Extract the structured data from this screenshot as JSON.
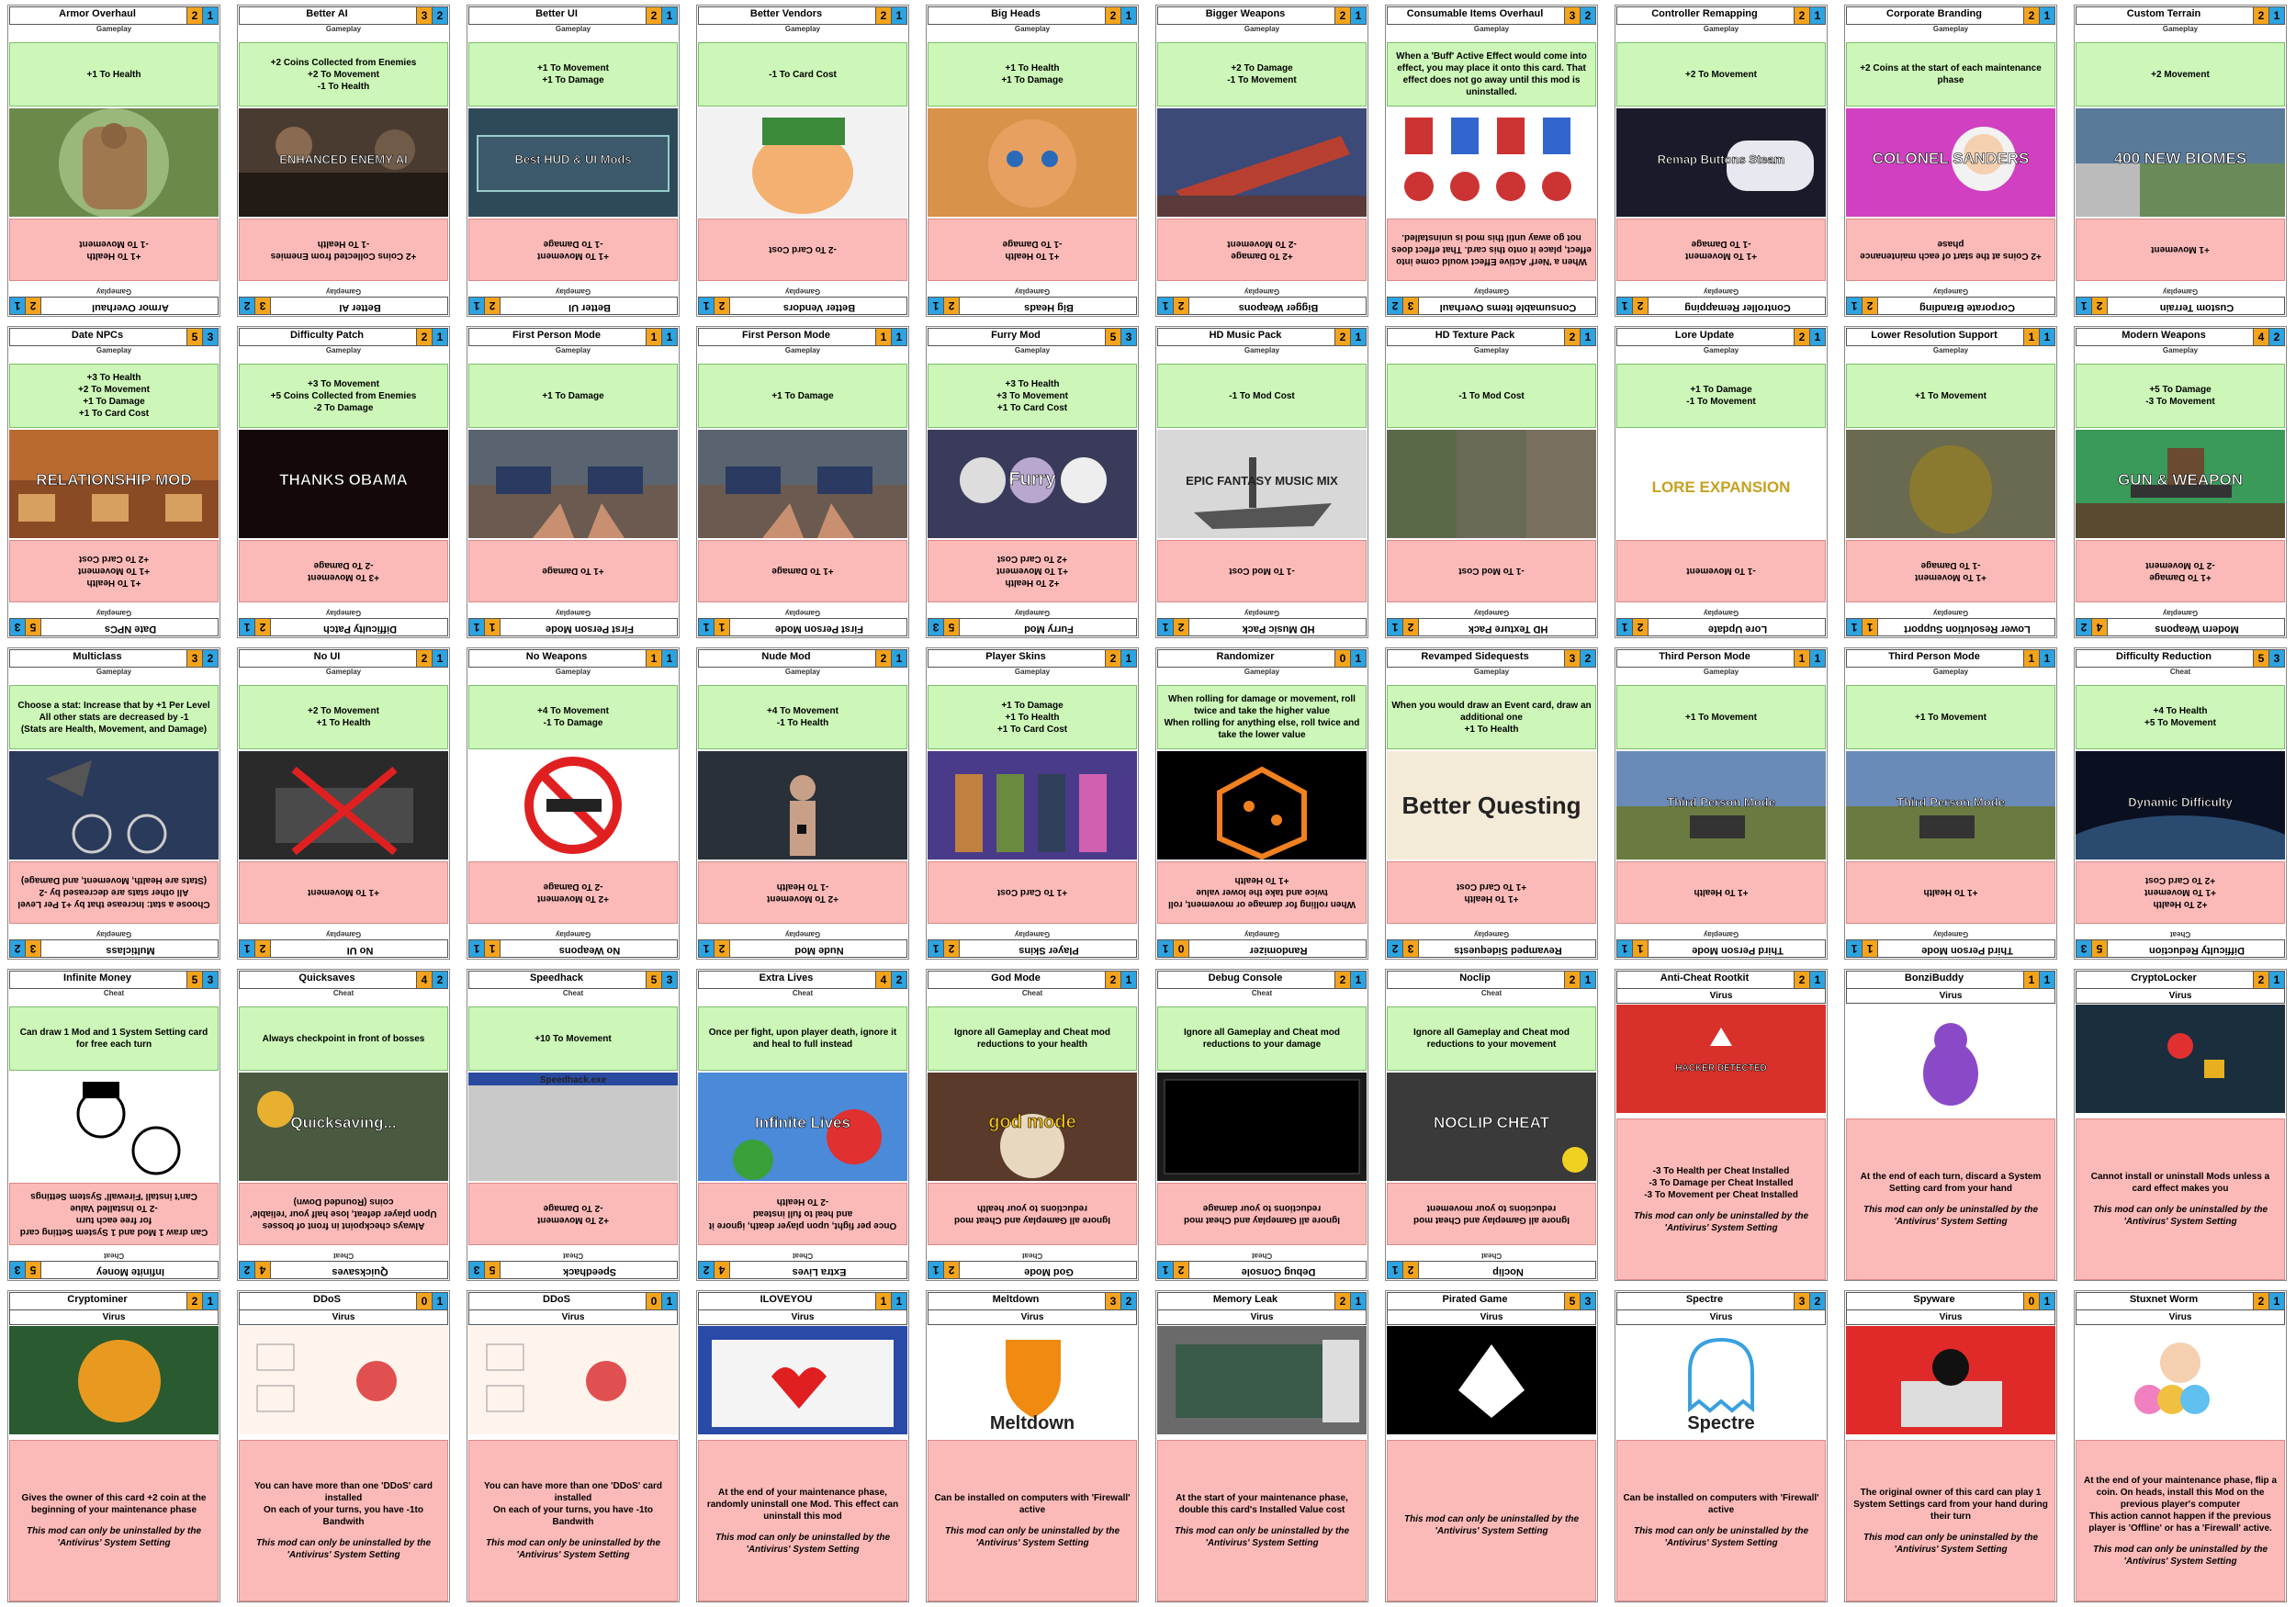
{
  "colors": {
    "buff": "#ccf7b8",
    "nerf": "#fbbab8",
    "cost": "#f4a41c",
    "slots": "#2da3e0"
  },
  "cards": [
    {
      "title": "Armor Overhaul",
      "cost": "2",
      "slots": "1",
      "tag": "Gameplay",
      "buff": "+1 To Health",
      "nerf": "+1 To Health\n-1 To Movement",
      "art": "armor-image"
    },
    {
      "title": "Better AI",
      "cost": "3",
      "slots": "2",
      "tag": "Gameplay",
      "buff": "+2 Coins Collected from Enemies\n+2 To Movement\n-1 To Health",
      "nerf": "+2 Coins Collected from Enemies\n-1 To Health",
      "art": "enemy-ai-image",
      "art_text": "ENHANCED ENEMY AI"
    },
    {
      "title": "Better UI",
      "cost": "2",
      "slots": "1",
      "tag": "Gameplay",
      "buff": "+1 To Movement\n+1 To Damage",
      "nerf": "+1 To Movement\n-1 To Damage",
      "art": "hud-image",
      "art_text": "Best HUD & UI Mods"
    },
    {
      "title": "Better Vendors",
      "cost": "2",
      "slots": "1",
      "tag": "Gameplay",
      "buff": "-1 To Card Cost",
      "nerf": "-2 To Card Cost",
      "art": "vendor-image"
    },
    {
      "title": "Big Heads",
      "cost": "2",
      "slots": "1",
      "tag": "Gameplay",
      "buff": "+1 To Health\n+1 To Damage",
      "nerf": "+1 To Health\n-1 To Damage",
      "art": "big-heads-image"
    },
    {
      "title": "Bigger Weapons",
      "cost": "2",
      "slots": "1",
      "tag": "Gameplay",
      "buff": "+2 To Damage\n-1 To Movement",
      "nerf": "+2 To Damage\n-2 To Movement",
      "art": "weapons-image"
    },
    {
      "title": "Consumable Items Overhaul",
      "cost": "3",
      "slots": "2",
      "tag": "Gameplay",
      "buff": "When a 'Buff' Active Effect would come into effect, you may place it onto this card. That effect does not go away until this mod is uninstalled.",
      "nerf": "When a 'Nerf' Active Effect would come into effect, place it onto this card. That effect does not go away until this mod is uninstalled.",
      "art": "potions-image"
    },
    {
      "title": "Controller Remapping",
      "cost": "2",
      "slots": "1",
      "tag": "Gameplay",
      "buff": "+2 To Movement",
      "nerf": "+1 To Movement\n-1 To Damage",
      "art": "controller-image",
      "art_text": "Remap Buttons Steam"
    },
    {
      "title": "Corporate Branding",
      "cost": "2",
      "slots": "1",
      "tag": "Gameplay",
      "buff": "+2 Coins at the start of each maintenance phase",
      "nerf": "+2 Coins at the start of each maintenance phase",
      "art": "sanders-image",
      "art_text": "COLONEL SANDERS"
    },
    {
      "title": "Custom Terrain",
      "cost": "2",
      "slots": "1",
      "tag": "Gameplay",
      "buff": "+2 Movement",
      "nerf": "+1 Movement",
      "art": "biomes-image",
      "art_text": "400 NEW BIOMES"
    },
    {
      "title": "Date NPCs",
      "cost": "5",
      "slots": "3",
      "tag": "Gameplay",
      "buff": "+3 To Health\n+2 To Movement\n+1 To Damage\n+1 To Card Cost",
      "nerf": "+1 To Health\n+1 To Movement\n+2 To Card Cost",
      "art": "relationship-image",
      "art_text": "RELATIONSHIP MOD"
    },
    {
      "title": "Difficulty Patch",
      "cost": "2",
      "slots": "1",
      "tag": "Gameplay",
      "buff": "+3 To Movement\n+5 Coins Collected from Enemies\n-2 To Damage",
      "nerf": "+3 To Movement\n-2 To Damage",
      "art": "dark-image",
      "art_text": "THANKS OBAMA"
    },
    {
      "title": "First Person Mode",
      "cost": "1",
      "slots": "1",
      "tag": "Gameplay",
      "buff": "+1 To Damage",
      "nerf": "+1 To Damage",
      "art": "fps-image"
    },
    {
      "title": "First Person Mode",
      "cost": "1",
      "slots": "1",
      "tag": "Gameplay",
      "buff": "+1 To Damage",
      "nerf": "+1 To Damage",
      "art": "fps-image"
    },
    {
      "title": "Furry Mod",
      "cost": "5",
      "slots": "3",
      "tag": "Gameplay",
      "buff": "+3 To Health\n+3 To Movement\n+1 To Card Cost",
      "nerf": "+2 To Health\n+1 To Movement\n+2 To Card Cost",
      "art": "furry-image",
      "art_text": "Furry"
    },
    {
      "title": "HD Music Pack",
      "cost": "2",
      "slots": "1",
      "tag": "Gameplay",
      "buff": "-1 To Mod Cost",
      "nerf": "-1 To Mod Cost",
      "art": "ship-image",
      "art_text": "EPIC FANTASY MUSIC MIX"
    },
    {
      "title": "HD Texture Pack",
      "cost": "2",
      "slots": "1",
      "tag": "Gameplay",
      "buff": "-1 To Mod Cost",
      "nerf": "-1 To Mod Cost",
      "art": "texture-image"
    },
    {
      "title": "Lore Update",
      "cost": "2",
      "slots": "1",
      "tag": "Gameplay",
      "buff": "+1 To Damage\n-1 To Movement",
      "nerf": "-1 To Movement",
      "art": "lore-image",
      "art_text": "LORE EXPANSION"
    },
    {
      "title": "Lower Resolution Support",
      "cost": "1",
      "slots": "1",
      "tag": "Gameplay",
      "buff": "+1 To Movement",
      "nerf": "+1 To Movement\n-1 To Damage",
      "art": "lowres-image"
    },
    {
      "title": "Modern Weapons",
      "cost": "4",
      "slots": "2",
      "tag": "Gameplay",
      "buff": "+5 To Damage\n-3 To Movement",
      "nerf": "+1 To Damage\n-2 To Movement",
      "art": "gun-image",
      "art_text": "GUN & WEAPON"
    },
    {
      "title": "Multiclass",
      "cost": "3",
      "slots": "2",
      "tag": "Gameplay",
      "buff": "Choose a stat: Increase that by +1 Per Level\nAll other stats are decreased by -1\n(Stats are Health, Movement, and Damage)",
      "nerf": "Choose a stat: Increase that by +1 Per Level\nAll other stats are decreased by -2\n(Stats are Health, Movement, and Damage)",
      "art": "bike-image"
    },
    {
      "title": "No UI",
      "cost": "2",
      "slots": "1",
      "tag": "Gameplay",
      "buff": "+2 To Movement\n+1 To Health",
      "nerf": "+1 To Movement",
      "art": "noui-image"
    },
    {
      "title": "No Weapons",
      "cost": "1",
      "slots": "1",
      "tag": "Gameplay",
      "buff": "+4 To Movement\n-1 To Damage",
      "nerf": "+2 To Movement\n-2 To Damage",
      "art": "noweapons-image"
    },
    {
      "title": "Nude Mod",
      "cost": "2",
      "slots": "1",
      "tag": "Gameplay",
      "buff": "+4 To Movement\n-1 To Health",
      "nerf": "+2 To Movement\n-1 To Health",
      "art": "nude-image"
    },
    {
      "title": "Player Skins",
      "cost": "2",
      "slots": "1",
      "tag": "Gameplay",
      "buff": "+1 To Damage\n+1 To Health\n+1 To Card Cost",
      "nerf": "+1 To Card Cost",
      "art": "skins-image"
    },
    {
      "title": "Randomizer",
      "cost": "0",
      "slots": "1",
      "tag": "Gameplay",
      "buff": "When rolling for damage or movement, roll twice and take the higher value\nWhen rolling for anything else, roll twice and take the lower value",
      "nerf": "When rolling for damage or movement, roll twice and take the lower value\n+1 To Health",
      "art": "dice-image"
    },
    {
      "title": "Revamped Sidequests",
      "cost": "3",
      "slots": "2",
      "tag": "Gameplay",
      "buff": "When you would draw an Event card, draw an additional one\n+1 To Health",
      "nerf": "+1 To Health\n+1 To Card Cost",
      "art": "questing-image",
      "art_text": "Better Questing"
    },
    {
      "title": "Third Person Mode",
      "cost": "1",
      "slots": "1",
      "tag": "Gameplay",
      "buff": "+1 To Movement",
      "nerf": "+1 To Health",
      "art": "tps-image",
      "art_text": "Third Person Mode"
    },
    {
      "title": "Third Person Mode",
      "cost": "1",
      "slots": "1",
      "tag": "Gameplay",
      "buff": "+1 To Movement",
      "nerf": "+1 To Health",
      "art": "tps-image",
      "art_text": "Third Person Mode"
    },
    {
      "title": "Difficulty Reduction",
      "cost": "5",
      "slots": "3",
      "tag": "Cheat",
      "buff": "+4 To Health\n+5 To Movement",
      "nerf": "+2 To Health\n+1 To Movement\n+2 To Card Cost",
      "art": "earth-image",
      "art_text": "Dynamic Difficulty"
    },
    {
      "title": "Infinite Money",
      "cost": "5",
      "slots": "3",
      "tag": "Cheat",
      "buff": "Can draw 1 Mod and 1 System Setting card for free each turn",
      "nerf": "Can draw 1 Mod and 1 System Setting card for free each turn\n-2 To Installed Value\nCan't install 'Firewall' System Settings",
      "art": "monopoly-image"
    },
    {
      "title": "Quicksaves",
      "cost": "4",
      "slots": "2",
      "tag": "Cheat",
      "buff": "Always checkpoint in front of bosses",
      "nerf": "Always checkpoint in front of bosses\nUpon player defeat, lose half your 'reliable' coins (Rounded Down)",
      "art": "quicksave-image",
      "art_text": "Quicksaving..."
    },
    {
      "title": "Speedhack",
      "cost": "5",
      "slots": "3",
      "tag": "Cheat",
      "buff": "+10 To Movement",
      "nerf": "+2 To Movement\n-2 To Damage",
      "art": "speedhack-image",
      "art_text": "Speedhack.exe"
    },
    {
      "title": "Extra Lives",
      "cost": "4",
      "slots": "2",
      "tag": "Cheat",
      "buff": "Once per fight, upon player death, ignore it and heal to full instead",
      "nerf": "Once per fight, upon player death, ignore it and heal to full instead\n-2 To Health",
      "art": "lives-image",
      "art_text": "Infinite Lives"
    },
    {
      "title": "God Mode",
      "cost": "2",
      "slots": "1",
      "tag": "Cheat",
      "buff": "Ignore all Gameplay and Cheat mod reductions to your health",
      "nerf": "Ignore all Gameplay and Cheat mod reductions to your health",
      "art": "godmode-image",
      "art_text": "god mode"
    },
    {
      "title": "Debug Console",
      "cost": "2",
      "slots": "1",
      "tag": "Cheat",
      "buff": "Ignore all Gameplay and Cheat mod reductions to your damage",
      "nerf": "Ignore all Gameplay and Cheat mod reductions to your damage",
      "art": "console-image"
    },
    {
      "title": "Noclip",
      "cost": "2",
      "slots": "1",
      "tag": "Cheat",
      "buff": "Ignore all Gameplay and Cheat mod reductions to your movement",
      "nerf": "Ignore all Gameplay and Cheat mod reductions to your movement",
      "art": "noclip-image",
      "art_text": "NOCLIP CHEAT"
    },
    {
      "title": "Anti-Cheat Rootkit",
      "cost": "2",
      "slots": "1",
      "tag": "Virus",
      "virus": true,
      "body": "-3 To Health per Cheat Installed\n-3 To Damage per Cheat Installed\n-3 To Movement per Cheat Installed",
      "note": "This mod can only be uninstalled by the 'Antivirus' System Setting",
      "art": "hacker-image",
      "art_text": "HACKER DETECTED"
    },
    {
      "title": "BonziBuddy",
      "cost": "1",
      "slots": "1",
      "tag": "Virus",
      "virus": true,
      "body": "At the end of each turn, discard a System Setting card from your hand",
      "note": "This mod can only be uninstalled by the 'Antivirus' System Setting",
      "art": "bonzi-image"
    },
    {
      "title": "CryptoLocker",
      "cost": "2",
      "slots": "1",
      "tag": "Virus",
      "virus": true,
      "body": "Cannot install or uninstall Mods unless a card effect makes you",
      "note": "This mod can only be uninstalled by the 'Antivirus' System Setting",
      "art": "cryptolocker-image"
    },
    {
      "title": "Cryptominer",
      "cost": "2",
      "slots": "1",
      "tag": "Virus",
      "virus": true,
      "body": "Gives the owner of this card +2 coin at the beginning of your maintenance phase",
      "note": "This mod can only be uninstalled by the 'Antivirus' System Setting",
      "art": "bitcoin-image"
    },
    {
      "title": "DDoS",
      "cost": "0",
      "slots": "1",
      "tag": "Virus",
      "virus": true,
      "body": "You can have more than one 'DDoS' card installed\nOn each of your turns, you have -1to Bandwith",
      "note": "This mod can only be uninstalled by the 'Antivirus' System Setting",
      "art": "ddos-image"
    },
    {
      "title": "DDoS",
      "cost": "0",
      "slots": "1",
      "tag": "Virus",
      "virus": true,
      "body": "You can have more than one 'DDoS' card installed\nOn each of your turns, you have -1to Bandwith",
      "note": "This mod can only be uninstalled by the 'Antivirus' System Setting",
      "art": "ddos-image"
    },
    {
      "title": "ILOVEYOU",
      "cost": "1",
      "slots": "1",
      "tag": "Virus",
      "virus": true,
      "body": "At the end of your maintenance phase, randomly uninstall one Mod. This effect can uninstall this mod",
      "note": "This mod can only be uninstalled by the 'Antivirus' System Setting",
      "art": "iloveyou-image"
    },
    {
      "title": "Meltdown",
      "cost": "3",
      "slots": "2",
      "tag": "Virus",
      "virus": true,
      "body": "Can be installed on computers with 'Firewall' active",
      "note": "This mod can only be uninstalled by the 'Antivirus' System Setting",
      "art": "meltdown-image",
      "art_text": "Meltdown"
    },
    {
      "title": "Memory Leak",
      "cost": "2",
      "slots": "1",
      "tag": "Virus",
      "virus": true,
      "body": "At the start of your maintenance phase, double this card's Installed Value cost",
      "note": "This mod can only be uninstalled by the 'Antivirus' System Setting",
      "art": "memory-image"
    },
    {
      "title": "Pirated Game",
      "cost": "5",
      "slots": "3",
      "tag": "Virus",
      "virus": true,
      "body": "",
      "note": "This mod can only be uninstalled by the 'Antivirus' System Setting",
      "art": "pirate-image"
    },
    {
      "title": "Spectre",
      "cost": "3",
      "slots": "2",
      "tag": "Virus",
      "virus": true,
      "body": "Can be installed on computers with 'Firewall' active",
      "note": "This mod can only be uninstalled by the 'Antivirus' System Setting",
      "art": "spectre-image",
      "art_text": "Spectre"
    },
    {
      "title": "Spyware",
      "cost": "0",
      "slots": "1",
      "tag": "Virus",
      "virus": true,
      "body": "The original owner of this card can play 1 System Settings card from your hand during their turn",
      "note": "This mod can only be uninstalled by the 'Antivirus' System Setting",
      "art": "spyware-image"
    },
    {
      "title": "Stuxnet Worm",
      "cost": "2",
      "slots": "1",
      "tag": "Virus",
      "virus": true,
      "body": "At the end of your maintenance phase, flip a coin. On heads, install this Mod on the previous player's computer\nThis action cannot happen if the previous player is 'Offline' or has a 'Firewall' active.",
      "note": "This mod can only be uninstalled by the 'Antivirus' System Setting",
      "art": "worm-image"
    }
  ]
}
